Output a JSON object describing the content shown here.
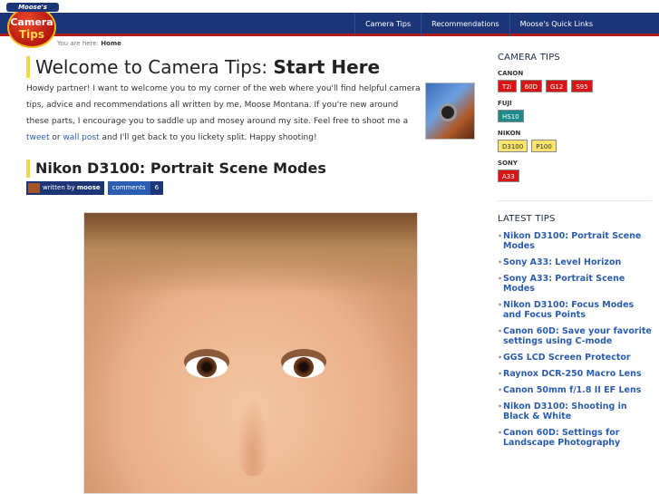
{
  "logo": {
    "top": "Moose's",
    "middle": "Camera",
    "bottom": "Tips"
  },
  "nav": [
    "Camera Tips",
    "Recommendations",
    "Moose's Quick Links"
  ],
  "breadcrumb": {
    "prefix": "You are here:",
    "current": "Home"
  },
  "welcome": {
    "title_plain": "Welcome to Camera Tips: ",
    "title_bold": "Start Here",
    "text_1": "Howdy partner! I want to welcome you to my corner of the web where you'll find helpful camera tips, advice and recommendations all written by me, Moose Montana. If you're new around these parts, I encourage you to saddle up and mosey around my site. Feel free to shoot me a ",
    "link_tweet": "tweet",
    "text_2": " or ",
    "link_wall": "wall post",
    "text_3": " and I'll get back to you lickety split. Happy shooting!"
  },
  "post": {
    "title": "Nikon D3100: Portrait Scene Modes",
    "author_prefix": "written by",
    "author": "moose",
    "comments_label": "comments",
    "comments_count": "6"
  },
  "sidebar": {
    "camera_tips_heading": "CAMERA TIPS",
    "groups": [
      {
        "brand": "CANON",
        "tags": [
          "T2i",
          "60D",
          "G12",
          "S95"
        ]
      },
      {
        "brand": "FUJI",
        "tags": [
          "HS10"
        ]
      },
      {
        "brand": "NIKON",
        "tags": [
          "D3100",
          "P100"
        ]
      },
      {
        "brand": "SONY",
        "tags": [
          "A33"
        ]
      }
    ],
    "latest_heading": "LATEST TIPS",
    "latest": [
      "Nikon D3100: Portrait Scene Modes",
      "Sony A33: Level Horizon",
      "Sony A33: Portrait Scene Modes",
      "Nikon D3100: Focus Modes and Focus Points",
      "Canon 60D: Save your favorite settings using C-mode",
      "GGS LCD Screen Protector",
      "Raynox DCR-250 Macro Lens",
      "Canon 50mm f/1.8 II EF Lens",
      "Nikon D3100: Shooting in Black & White",
      "Canon 60D: Settings for Landscape Photography"
    ]
  },
  "colors": {
    "nav_bg": "#1c3577",
    "nav_border": "#b11a1a",
    "accent_yellow": "#f3d54a",
    "link": "#2a5db0",
    "tag_red": "#d81515",
    "tag_teal": "#1f8a8a",
    "tag_yellow": "#f8e46a"
  }
}
